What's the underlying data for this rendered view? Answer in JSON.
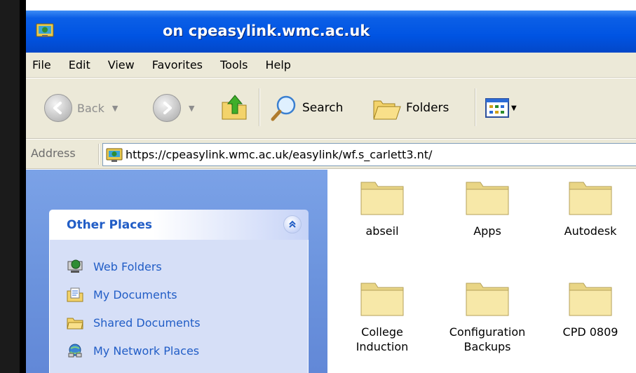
{
  "window": {
    "title": "on cpeasylink.wmc.ac.uk"
  },
  "menu": {
    "items": [
      "File",
      "Edit",
      "View",
      "Favorites",
      "Tools",
      "Help"
    ]
  },
  "toolbar": {
    "back_label": "Back",
    "search_label": "Search",
    "folders_label": "Folders"
  },
  "address": {
    "label": "Address",
    "value": "https://cpeasylink.wmc.ac.uk/easylink/wf.s_carlett3.nt/"
  },
  "other_places": {
    "title": "Other Places",
    "items": [
      {
        "label": "Web Folders",
        "icon": "web-folders-icon"
      },
      {
        "label": "My Documents",
        "icon": "my-documents-icon"
      },
      {
        "label": "Shared Documents",
        "icon": "shared-documents-icon"
      },
      {
        "label": "My Network Places",
        "icon": "network-places-icon"
      }
    ]
  },
  "files": [
    {
      "line1": "abseil",
      "line2": ""
    },
    {
      "line1": "Apps",
      "line2": ""
    },
    {
      "line1": "Autodesk",
      "line2": ""
    },
    {
      "line1": "College",
      "line2": "Induction"
    },
    {
      "line1": "Configuration",
      "line2": "Backups"
    },
    {
      "line1": "CPD 0809",
      "line2": ""
    }
  ],
  "colors": {
    "titlebar": "#0054e3",
    "toolbar_bg": "#ece9d8",
    "taskpane_bg": "#6b93dd",
    "link_blue": "#215dc6",
    "folder_yellow": "#f7e6a2"
  }
}
